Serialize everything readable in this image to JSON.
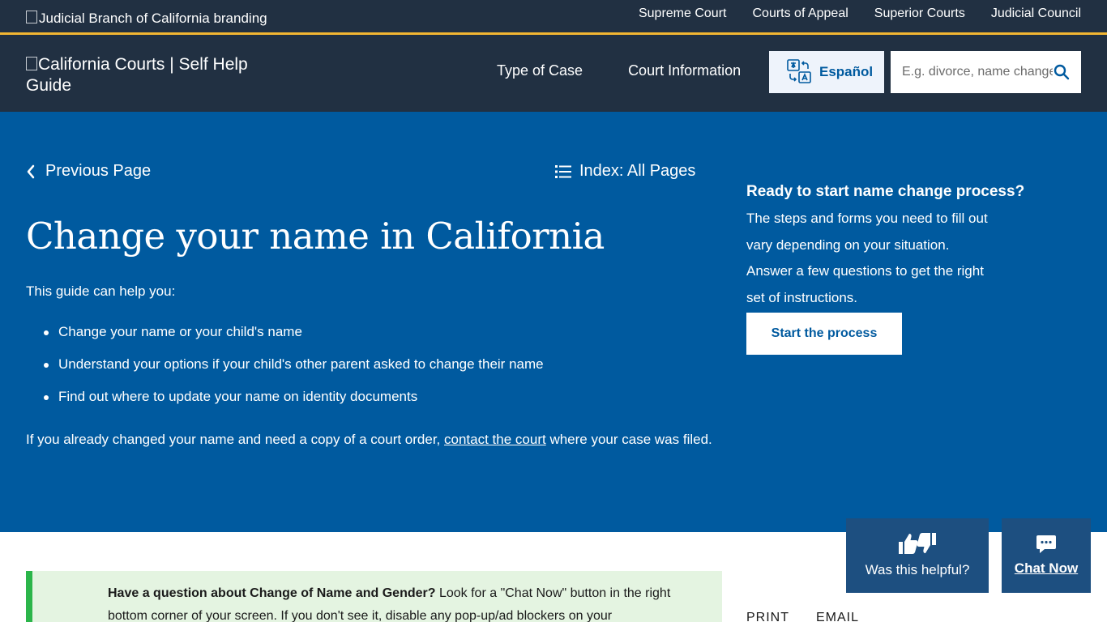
{
  "topbar": {
    "brand_alt": "Judicial Branch of California branding",
    "links": [
      "Supreme Court",
      "Courts of Appeal",
      "Superior Courts",
      "Judicial Council"
    ]
  },
  "header": {
    "logo_alt": "California Courts | Self Help Guide",
    "nav": [
      "Type of Case",
      "Court Information"
    ],
    "language_label": "Español",
    "search_placeholder": "E.g. divorce, name change"
  },
  "hero": {
    "previous_label": "Previous Page",
    "index_label": "Index: All Pages",
    "title": "Change your name in California",
    "intro": "This guide can help you:",
    "bullets": [
      "Change your name or your child's name",
      "Understand your options if your child's other parent asked to change their name",
      "Find out where to update your name on identity documents"
    ],
    "note_before": "If you already changed your name and need a copy of a court order,",
    "note_link": "contact the court",
    "note_after": "where your case was filed."
  },
  "cta": {
    "heading": "Ready to start name change process?",
    "body": "The steps and forms you need to fill out vary depending on your situation. Answer a few questions to get the right set of instructions.",
    "button": "Start the process"
  },
  "callout": {
    "bold": "Have a question about Change of Name and Gender?",
    "text": "Look for a \"Chat Now\" button in the right bottom corner of your screen. If you don't see it, disable any pop-up/ad blockers on your"
  },
  "actions": {
    "print": "PRINT",
    "email": "EMAIL"
  },
  "widgets": {
    "helpful": "Was this helpful?",
    "chat": "Chat Now"
  },
  "colors": {
    "nav_bg": "#213042",
    "accent_gold": "#f2b632",
    "hero_bg": "#005a9f",
    "widget_bg": "#1d4f80",
    "callout_bg": "#e4f4e1",
    "callout_border": "#2bb54a"
  }
}
